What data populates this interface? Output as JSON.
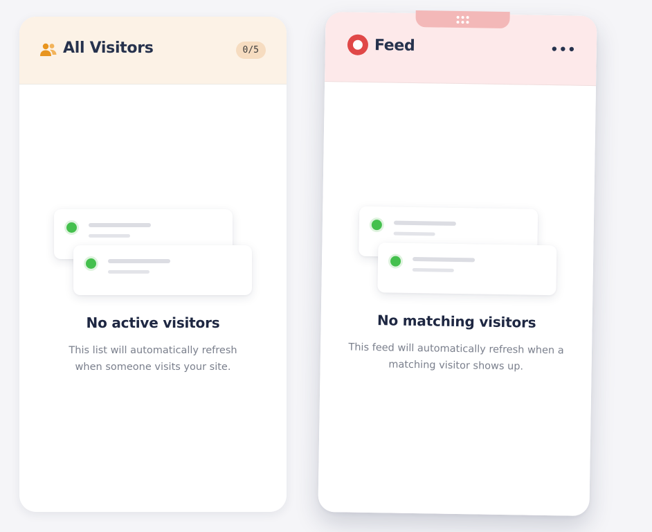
{
  "visitors_panel": {
    "title": "All Visitors",
    "icon": "users-icon",
    "count_badge": "0/5",
    "empty_title": "No active visitors",
    "empty_text": "This list will automatically refresh when someone visits your site."
  },
  "feed_panel": {
    "title": "Feed",
    "icon": "feed-ring-icon",
    "menu_label": "•••",
    "drag_handle_icon": "grip-dots-icon",
    "empty_title": "No matching visitors",
    "empty_text": "This feed will automatically refresh when a matching visitor shows up."
  },
  "colors": {
    "visitors_header_bg": "#fcf2e6",
    "feed_header_bg": "#fde9ea",
    "feed_accent": "#e04848",
    "visitors_accent": "#e8951f",
    "online_dot": "#44c04d"
  }
}
